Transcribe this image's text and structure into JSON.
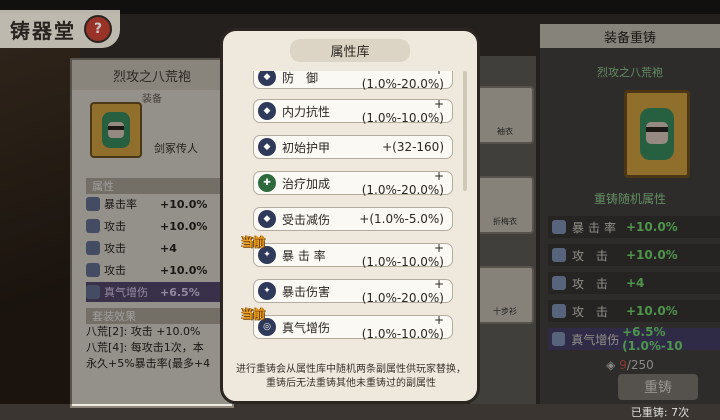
{
  "header": {
    "title": "铸器堂",
    "help_label": "?"
  },
  "left_card": {
    "item_name": "烈攻之八荒袍",
    "item_type": "装备",
    "person": "剑冢传人",
    "attr_header": "属性",
    "stats": [
      {
        "name": "暴击率",
        "value": "+10.0%"
      },
      {
        "name": "攻击",
        "value": "+10.0%"
      },
      {
        "name": "攻击",
        "value": "+4"
      },
      {
        "name": "攻击",
        "value": "+10.0%"
      },
      {
        "name": "真气增伤",
        "value": "+6.5%"
      }
    ],
    "set_header": "套装效果",
    "set_lines": [
      "八荒[2]: 攻击 +10.0%",
      "八荒[4]: 每攻击1次，本",
      "永久+5%暴击率(最多+4"
    ]
  },
  "middle_cards": [
    "袖衣",
    "折梅衣",
    "十步衫"
  ],
  "modal": {
    "title": "属性库",
    "current_tag": "当前",
    "attributes": [
      {
        "name": "防　御",
        "range": "+(1.0%-20.0%)",
        "current": false
      },
      {
        "name": "内力抗性",
        "range": "+(1.0%-10.0%)",
        "current": false
      },
      {
        "name": "初始护甲",
        "range": "+(32-160)",
        "current": false
      },
      {
        "name": "治疗加成",
        "range": "+(1.0%-20.0%)",
        "current": false
      },
      {
        "name": "受击减伤",
        "range": "+(1.0%-5.0%)",
        "current": false
      },
      {
        "name": "暴 击 率",
        "range": "+(1.0%-10.0%)",
        "current": true
      },
      {
        "name": "暴击伤害",
        "range": "+(1.0%-20.0%)",
        "current": false
      },
      {
        "name": "真气增伤",
        "range": "+(1.0%-10.0%)",
        "current": true
      }
    ],
    "description": "进行重铸会从属性库中随机两条副属性供玩家替换，重铸后无法重铸其他未重铸过的副属性"
  },
  "right_panel": {
    "header": "装备重铸",
    "item_name": "烈攻之八荒袍",
    "attr_title": "重铸随机属性",
    "stats": [
      {
        "name": "暴击率",
        "value": "+10.0%"
      },
      {
        "name": "攻 击",
        "value": "+10.0%"
      },
      {
        "name": "攻 击",
        "value": "+4"
      },
      {
        "name": "攻 击",
        "value": "+10.0%"
      },
      {
        "name": "真气增伤",
        "value": "+6.5%(1.0%-10"
      }
    ],
    "cost_current": "9",
    "cost_total": "/250",
    "recast_button": "重铸",
    "recast_count": "已重铸: 7次"
  },
  "colors": {
    "accent_green": "#7ef07a",
    "current_orange": "#f0a020",
    "panel_cream": "#efe9dd"
  }
}
